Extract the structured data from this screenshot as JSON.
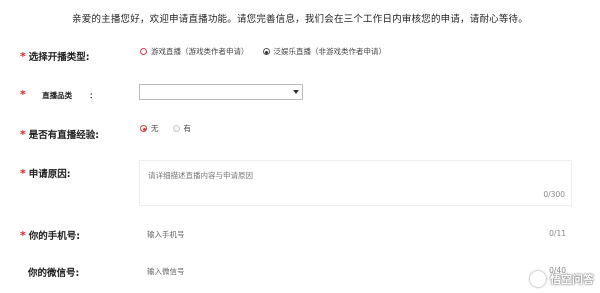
{
  "notice": "亲爱的主播您好，欢迎申请直播功能。请您完善信息，我们会在三个工作日内审核您的申请，请耐心等待。",
  "required_mark": "*",
  "broadcast_type": {
    "label": "选择开播类型:",
    "options": [
      {
        "label": "游戏直播（游戏类作者申请）",
        "selected": false
      },
      {
        "label": "泛娱乐直播（非游戏类作者申请）",
        "selected": true
      }
    ]
  },
  "category": {
    "label": "直播品类",
    "colon": "：",
    "value": ""
  },
  "experience": {
    "label": "是否有直播经验:",
    "options": [
      {
        "label": "无",
        "selected": true
      },
      {
        "label": "有",
        "selected": false
      }
    ]
  },
  "reason": {
    "label": "申请原因:",
    "placeholder": "请详细描述直播内容与申请原因",
    "counter": "0/300"
  },
  "phone": {
    "label": "你的手机号:",
    "placeholder": "输入手机号",
    "counter": "0/11"
  },
  "wechat": {
    "label": "你的微信号:",
    "placeholder": "输入微信号",
    "counter": "0/40"
  },
  "watermark": {
    "text": "悟空问答",
    "icon": "wukong-logo-icon"
  },
  "colors": {
    "required": "#e02020",
    "radio_accent": "#e23c3c"
  }
}
